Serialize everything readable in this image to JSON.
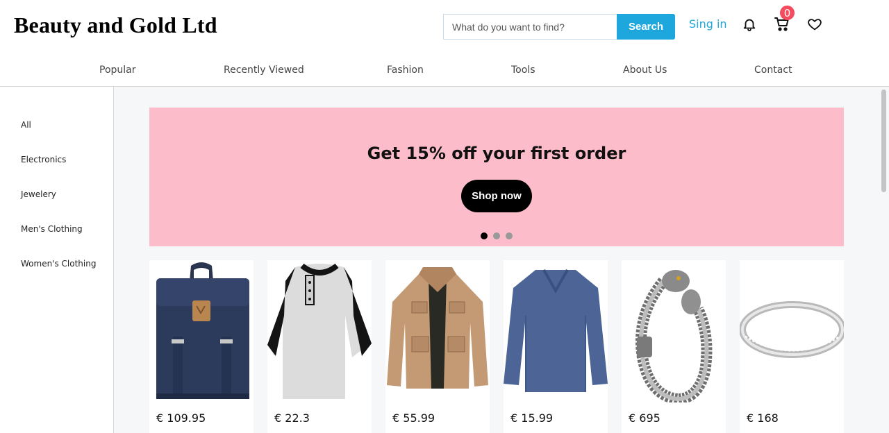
{
  "header": {
    "logo": "Beauty and Gold Ltd",
    "search_placeholder": "What do you want to find?",
    "search_button": "Search",
    "signin_label": "Sing in",
    "cart_count": "0",
    "icons": [
      "bell-icon",
      "cart-icon",
      "heart-icon"
    ]
  },
  "nav": {
    "items": [
      "Popular",
      "Recently Viewed",
      "Fashion",
      "Tools",
      "About Us",
      "Contact"
    ]
  },
  "sidebar": {
    "items": [
      "All",
      "Electronics",
      "Jewelery",
      "Men's Clothing",
      "Women's Clothing"
    ]
  },
  "banner": {
    "title": "Get 15% off your first order",
    "button": "Shop now",
    "background": "#fdbcc9",
    "slides_count": 3,
    "active_slide": 1
  },
  "products": [
    {
      "image": "backpack",
      "price": "€ 109.95"
    },
    {
      "image": "raglan-tshirt",
      "price": "€ 22.3"
    },
    {
      "image": "jacket",
      "price": "€ 55.99"
    },
    {
      "image": "long-sleeve-shirt",
      "price": "€ 15.99"
    },
    {
      "image": "dragon-bracelet",
      "price": "€ 695"
    },
    {
      "image": "ring",
      "price": "€ 168"
    }
  ],
  "colors": {
    "accent": "#1ea7dc",
    "badge": "#f44b5e"
  }
}
